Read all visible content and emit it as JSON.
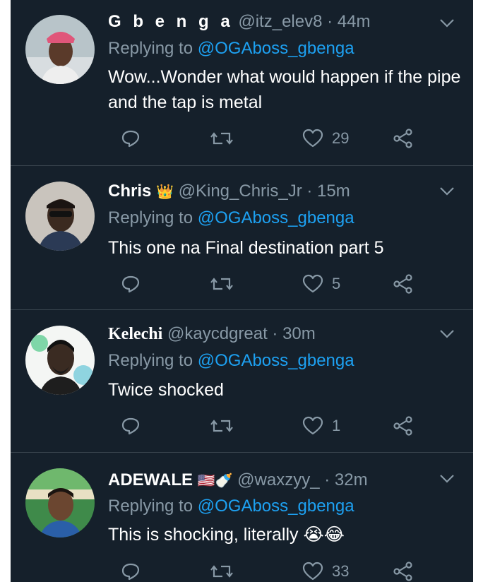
{
  "replying_prefix": "Replying to",
  "replies": [
    {
      "name": "G b e n g a",
      "badges": "",
      "handle": "@itz_elev8",
      "time": "· 44m",
      "replying_to": "@OGAboss_gbenga",
      "text": "Wow...Wonder what would happen if the pipe and the tap is metal",
      "likes": "29"
    },
    {
      "name": "Chris",
      "badges": "👑",
      "handle": "@King_Chris_Jr",
      "time": "· 15m",
      "replying_to": "@OGAboss_gbenga",
      "text": "This one na Final destination part 5",
      "likes": "5"
    },
    {
      "name": "Kelechi",
      "badges": "",
      "handle": "@kaycdgreat",
      "time": "· 30m",
      "replying_to": "@OGAboss_gbenga",
      "text": "Twice shocked",
      "likes": "1"
    },
    {
      "name": "ADEWALE",
      "badges": "🇺🇸🍼",
      "handle": "@waxzyy_",
      "time": "· 32m",
      "replying_to": "@OGAboss_gbenga",
      "text": "This is shocking, literally 😭😂",
      "likes": "33"
    }
  ],
  "icons": {
    "reply": "reply-icon",
    "retweet": "retweet-icon",
    "like": "heart-icon",
    "share": "share-icon",
    "menu": "chevron-down-icon"
  },
  "colors": {
    "background": "#15202b",
    "text": "#ffffff",
    "muted": "#8899a6",
    "link": "#1da1f2",
    "divider": "#38444d"
  }
}
